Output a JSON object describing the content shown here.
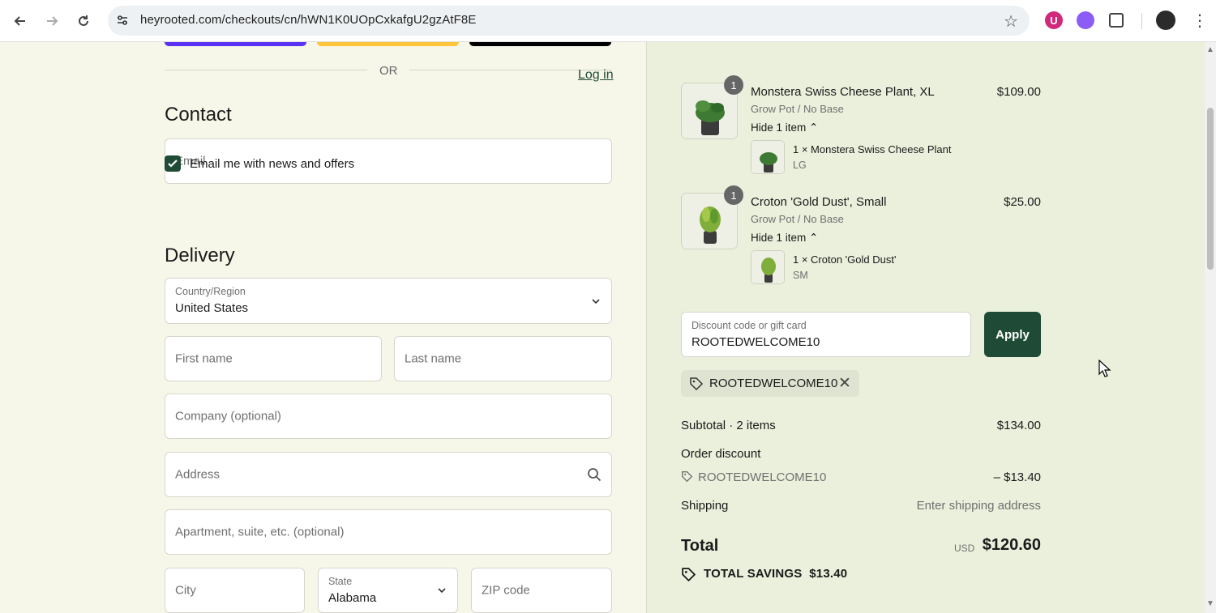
{
  "browser": {
    "url": "heyrooted.com/checkouts/cn/hWN1K0UOpCxkafgU2gzAtF8E",
    "ext_u_label": "U"
  },
  "colors": {
    "accent": "#1f4b36",
    "left_bg": "#f7f7e9",
    "right_bg": "#eaf0dc",
    "paybar_1": "#5a31f4",
    "paybar_2": "#ffc439",
    "paybar_3": "#000000"
  },
  "express": {
    "or_text": "OR"
  },
  "contact": {
    "title": "Contact",
    "login_label": "Log in",
    "email_placeholder": "Email",
    "newsletter_label": "Email me with news and offers",
    "newsletter_checked": true
  },
  "delivery": {
    "title": "Delivery",
    "country_label": "Country/Region",
    "country_value": "United States",
    "first_name_placeholder": "First name",
    "last_name_placeholder": "Last name",
    "company_placeholder": "Company (optional)",
    "address_placeholder": "Address",
    "apartment_placeholder": "Apartment, suite, etc. (optional)",
    "city_placeholder": "City",
    "state_label": "State",
    "state_value": "Alabama",
    "zip_placeholder": "ZIP code"
  },
  "cart": {
    "items": [
      {
        "qty": "1",
        "name": "Monstera Swiss Cheese Plant, XL",
        "variant": "Grow Pot / No Base",
        "hide_label": "Hide 1 item",
        "sub_name": "1 × Monstera Swiss Cheese Plant",
        "sub_variant": "LG",
        "price": "$109.00"
      },
      {
        "qty": "1",
        "name": "Croton 'Gold Dust', Small",
        "variant": "Grow Pot / No Base",
        "hide_label": "Hide 1 item",
        "sub_name": "1 × Croton 'Gold Dust'",
        "sub_variant": "SM",
        "price": "$25.00"
      }
    ],
    "discount_label": "Discount code or gift card",
    "discount_value": "ROOTEDWELCOME10",
    "apply_label": "Apply",
    "applied_code": "ROOTEDWELCOME10"
  },
  "summary": {
    "subtotal_label": "Subtotal · 2 items",
    "subtotal_value": "$134.00",
    "order_discount_label": "Order discount",
    "discount_code": "ROOTEDWELCOME10",
    "discount_value": "– $13.40",
    "shipping_label": "Shipping",
    "shipping_value": "Enter shipping address",
    "total_label": "Total",
    "currency": "USD",
    "total_value": "$120.60",
    "savings_label": "TOTAL SAVINGS",
    "savings_value": "$13.40"
  }
}
